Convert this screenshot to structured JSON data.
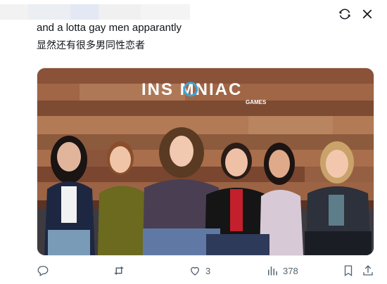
{
  "post": {
    "text_en": "and a lotta gay men apparantly",
    "text_zh": "显然还有很多男同性恋者"
  },
  "media": {
    "logo_main": "INS  MNIAC",
    "logo_sub": "GAMES",
    "description_icon": "photo"
  },
  "actions": {
    "reply_count": "",
    "retweet_count": "",
    "like_count": "3",
    "views_count": "378"
  },
  "icons": {
    "top": [
      "refresh-icon",
      "close-icon"
    ],
    "bar": [
      "reply-icon",
      "retweet-icon",
      "like-icon",
      "views-icon",
      "bookmark-icon",
      "share-icon"
    ]
  },
  "colors": {
    "text": "#0f1419",
    "muted": "#536471",
    "wood_dark": "#7a4a32",
    "wood_light": "#b07a58",
    "logo_blue": "#3aa6d8"
  }
}
